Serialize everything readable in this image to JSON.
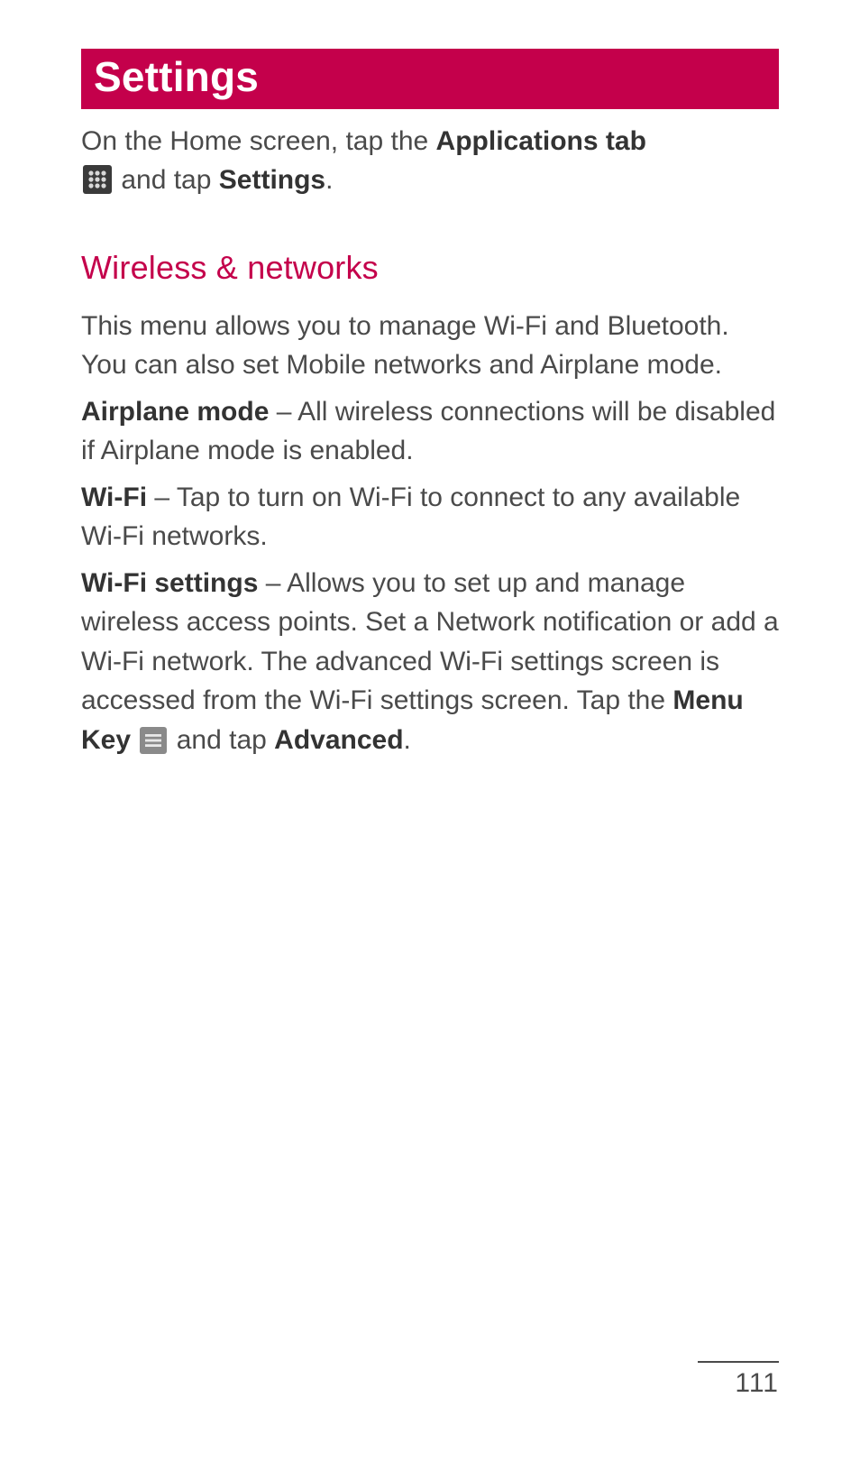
{
  "header": {
    "title": "Settings"
  },
  "intro": {
    "line1_pre": "On the Home screen, tap the ",
    "line1_bold": "Applications tab",
    "line2_mid": " and tap ",
    "line2_bold": "Settings",
    "line2_post": "."
  },
  "section": {
    "heading": "Wireless & networks"
  },
  "paragraphs": {
    "p1": "This menu allows you to manage Wi-Fi and Bluetooth. You can also set Mobile networks and Airplane mode.",
    "p2_bold": "Airplane mode",
    "p2_text": " – All wireless connections will be disabled if Airplane mode is enabled.",
    "p3_bold": "Wi-Fi",
    "p3_text": " – Tap to turn on Wi-Fi to connect to any available Wi-Fi networks.",
    "p4_bold": "Wi-Fi settings",
    "p4_text_a": " – Allows you to set up and manage wireless access points. Set a Network notification or add a Wi-Fi network. The advanced Wi-Fi settings screen is accessed from the Wi-Fi settings screen. Tap the ",
    "p4_bold2": "Menu Key",
    "p4_text_b": " and tap ",
    "p4_bold3": "Advanced",
    "p4_text_c": "."
  },
  "page_number": "111"
}
